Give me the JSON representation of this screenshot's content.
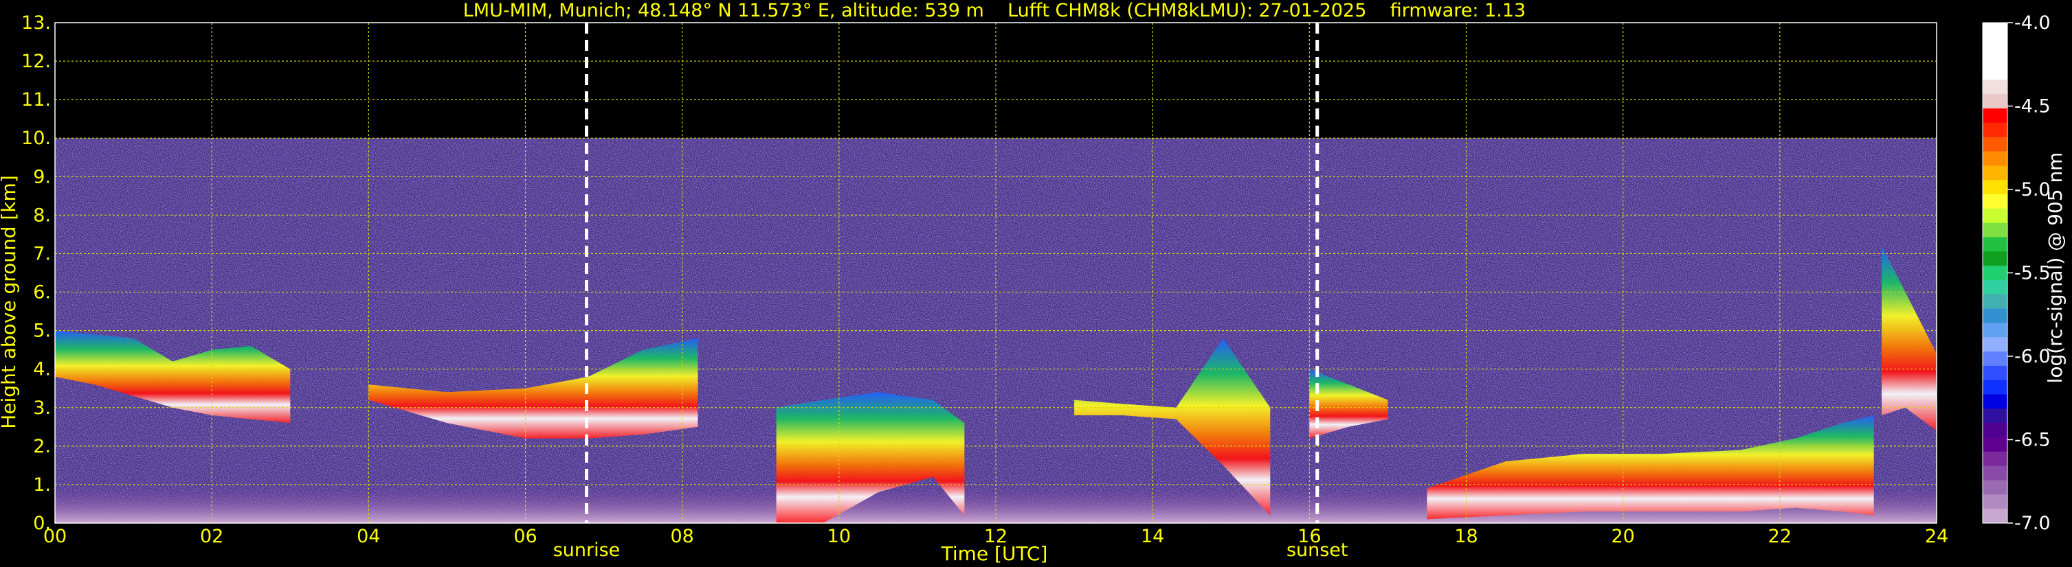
{
  "chart_data": {
    "type": "heatmap",
    "title": "LMU-MIM, Munich; 48.148° N 11.573° E, altitude: 539 m    Lufft CHM8k (CHM8kLMU): 27-01-2025    firmware: 1.13",
    "xlabel": "Time [UTC]",
    "ylabel": "Height above ground [km]",
    "xlim": [
      0,
      24
    ],
    "ylim": [
      0,
      13
    ],
    "x_ticks": [
      "00",
      "02",
      "04",
      "06",
      "08",
      "10",
      "12",
      "14",
      "16",
      "18",
      "20",
      "22",
      "24"
    ],
    "y_ticks": [
      "0.",
      "1.",
      "2.",
      "3.",
      "4.",
      "5.",
      "6.",
      "7.",
      "8.",
      "9.",
      "10.",
      "11.",
      "12.",
      "13."
    ],
    "grid": true,
    "max_signal_height_km": 10,
    "markers": [
      {
        "label": "sunrise",
        "x": 6.78
      },
      {
        "label": "sunset",
        "x": 16.1
      }
    ],
    "colorbar": {
      "label": "log(rc-signal) @ 905 nm",
      "range": [
        -7.0,
        -4.0
      ],
      "ticks": [
        "-4.0",
        "-4.5",
        "-5.0",
        "-5.5",
        "-6.0",
        "-6.5",
        "-7.0"
      ]
    },
    "layers": [
      {
        "t": [
          0.0,
          0.5,
          1.0,
          1.5,
          2.0,
          2.5,
          3.0
        ],
        "base_km": [
          3.8,
          3.6,
          3.3,
          3.0,
          2.8,
          2.7,
          2.6
        ],
        "top_km": [
          5.0,
          4.9,
          4.8,
          4.2,
          4.5,
          4.6,
          4.0
        ]
      },
      {
        "t": [
          4.0,
          5.0,
          6.0,
          6.8,
          7.5,
          8.2
        ],
        "base_km": [
          3.2,
          2.6,
          2.2,
          2.2,
          2.3,
          2.5
        ],
        "top_km": [
          3.6,
          3.4,
          3.5,
          3.8,
          4.5,
          4.8
        ]
      },
      {
        "t": [
          9.2,
          9.8,
          10.5,
          11.2,
          11.6
        ],
        "base_km": [
          0.0,
          0.0,
          0.8,
          1.2,
          0.2
        ],
        "top_km": [
          3.0,
          3.2,
          3.4,
          3.2,
          2.6
        ]
      },
      {
        "t": [
          13.0,
          13.6,
          14.3,
          14.9,
          15.5
        ],
        "base_km": [
          2.8,
          2.8,
          2.7,
          1.5,
          0.2
        ],
        "top_km": [
          3.2,
          3.1,
          3.0,
          4.8,
          3.0
        ]
      },
      {
        "t": [
          16.0,
          16.5,
          17.0
        ],
        "base_km": [
          2.2,
          2.5,
          2.7
        ],
        "top_km": [
          4.0,
          3.6,
          3.2
        ]
      },
      {
        "t": [
          17.5,
          18.5,
          19.5,
          20.5,
          21.5,
          22.2,
          22.8,
          23.2
        ],
        "base_km": [
          0.1,
          0.2,
          0.3,
          0.3,
          0.3,
          0.4,
          0.3,
          0.2
        ],
        "top_km": [
          0.9,
          1.6,
          1.8,
          1.8,
          1.9,
          2.2,
          2.6,
          2.8
        ]
      },
      {
        "t": [
          23.3,
          23.6,
          24.0
        ],
        "base_km": [
          2.8,
          3.0,
          2.4
        ],
        "top_km": [
          7.2,
          6.0,
          4.4
        ]
      }
    ]
  }
}
